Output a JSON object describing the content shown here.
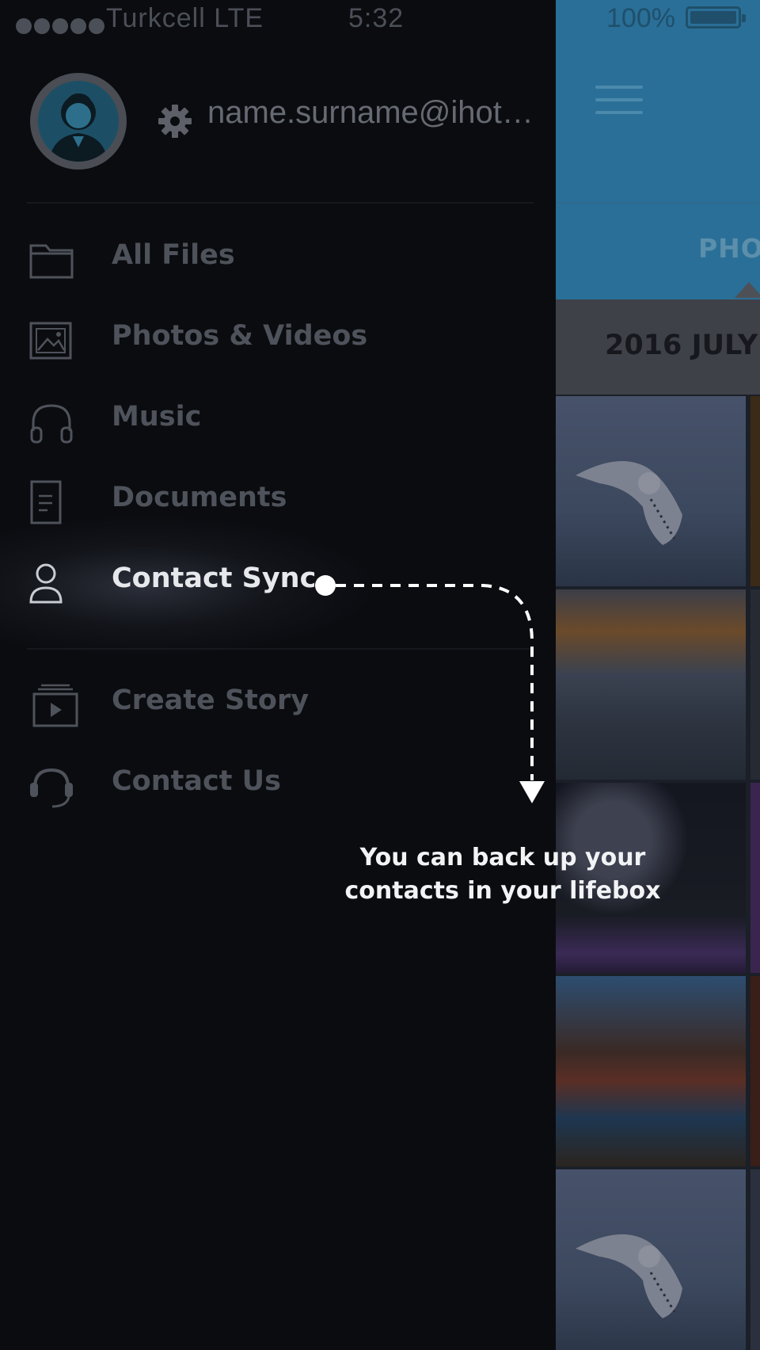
{
  "status_bar": {
    "carrier": "Turkcell  LTE",
    "time": "5:32",
    "battery": "100%"
  },
  "drawer": {
    "email": "name.surname@ihotmail.com",
    "menu_items": [
      {
        "label": "All Files",
        "icon": "folder-icon"
      },
      {
        "label": "Photos & Videos",
        "icon": "image-icon"
      },
      {
        "label": "Music",
        "icon": "headphones-icon"
      },
      {
        "label": "Documents",
        "icon": "document-icon"
      },
      {
        "label": "Contact Sync",
        "icon": "person-icon",
        "active": true
      }
    ],
    "secondary_items": [
      {
        "label": "Create Story",
        "icon": "story-play-icon"
      },
      {
        "label": "Contact Us",
        "icon": "headset-icon"
      }
    ]
  },
  "background_app": {
    "tab": "PHOTOS",
    "date_header": "2016 JULY"
  },
  "hint": {
    "text": "You can back up your contacts in your lifebox"
  }
}
